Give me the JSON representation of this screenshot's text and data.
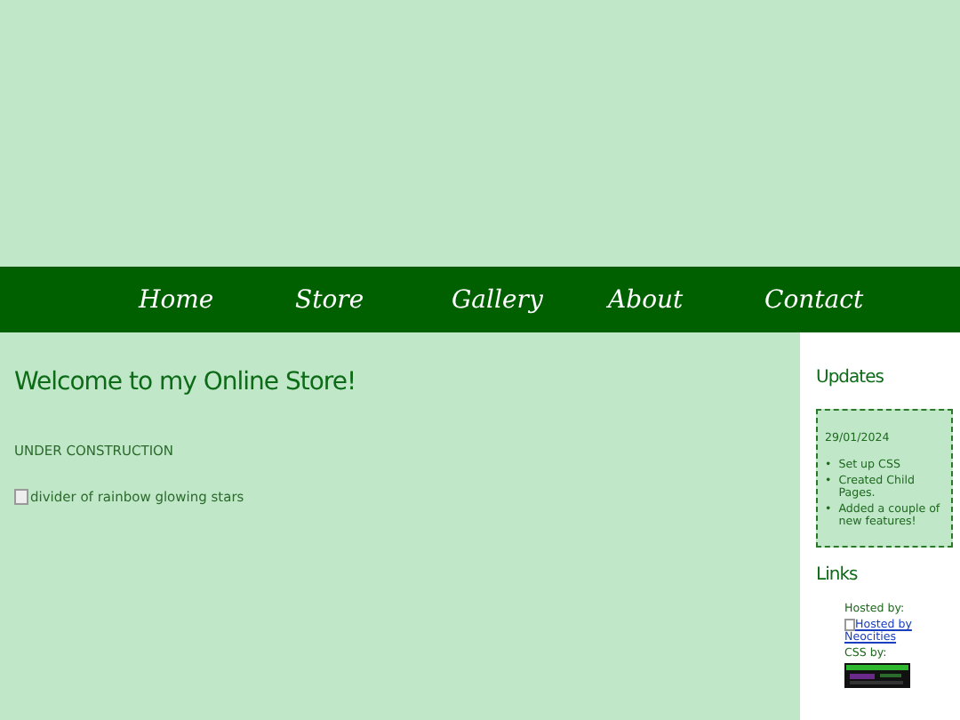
{
  "nav": [
    {
      "label": "Home"
    },
    {
      "label": "Store"
    },
    {
      "label": "Gallery"
    },
    {
      "label": "About"
    },
    {
      "label": "Contact"
    }
  ],
  "main": {
    "heading": "Welcome to my Online Store!",
    "notice": "UNDER CONSTRUCTION",
    "broken_image_alt": "divider of rainbow glowing stars"
  },
  "sidebar": {
    "updates_title": "Updates",
    "update": {
      "date": "29/01/2024",
      "items": [
        {
          "marker": "•",
          "text": "Set up CSS"
        },
        {
          "marker": "•",
          "text": "Created Child Pages."
        },
        {
          "marker": "•",
          "text": "Added a couple of new features!"
        }
      ]
    },
    "links_title": "Links",
    "hosted_label": "Hosted by:",
    "hosted_link": "Hosted by Neocities",
    "css_label": "CSS by:"
  }
}
